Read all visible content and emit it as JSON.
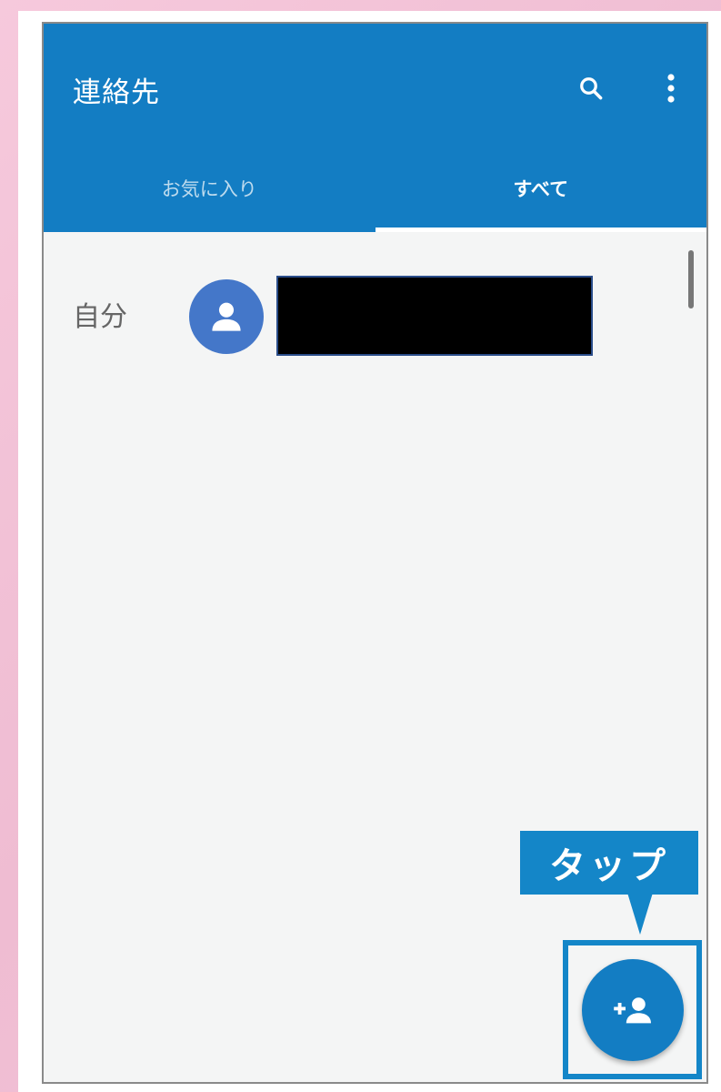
{
  "app": {
    "title": "連絡先"
  },
  "toolbar": {
    "search_icon": "search-icon",
    "more_icon": "more-vert-icon"
  },
  "tabs": [
    {
      "label": "お気に入り",
      "selected": false
    },
    {
      "label": "すべて",
      "selected": true
    }
  ],
  "me_section": {
    "label": "自分",
    "avatar_icon": "person-icon",
    "name_redacted": true
  },
  "callout": {
    "text": "タップ"
  },
  "fab": {
    "icon": "add-contact-icon"
  },
  "colors": {
    "appbar": "#137dc3",
    "accent": "#1486c8",
    "avatar": "#4477c9",
    "background": "#f4f5f5",
    "page_bg": "#f6c9dc"
  }
}
